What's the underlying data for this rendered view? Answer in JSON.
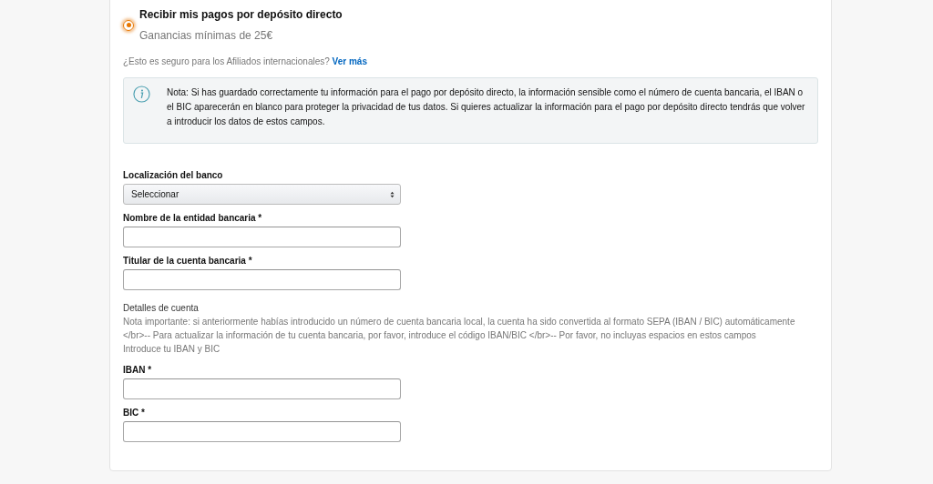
{
  "payment_option": {
    "title": "Recibir mis pagos por depósito directo",
    "subtitle": "Ganancias mínimas de 25€",
    "selected": true
  },
  "safety_question": {
    "text": "¿Esto es seguro para los Afiliados internacionales?",
    "link": "Ver más"
  },
  "notice": "Nota: Si has guardado correctamente tu información para el pago por depósito directo, la información sensible como el número de cuenta bancaria, el IBAN o el BIC aparecerán en blanco para proteger la privacidad de tus datos. Si quieres actualizar la información para el pago por depósito directo tendrás que volver a introducir los datos de estos campos.",
  "bank_fields": [
    {
      "kind": "select",
      "label": "Localización del banco",
      "value": "Seleccionar"
    },
    {
      "kind": "text",
      "label": "Nombre de la entidad bancaria *"
    },
    {
      "kind": "text",
      "label": "Titular de la cuenta bancaria *"
    }
  ],
  "account_details": {
    "heading": "Detalles de cuenta",
    "note": "Nota importante: si anteriormente habías introducido un número de cuenta bancaria local, la cuenta ha sido convertida al formato SEPA (IBAN / BIC) automáticamente </br>-- Para actualizar la información de tu cuenta bancaria, por favor, introduce el código IBAN/BIC </br>-- Por favor, no incluyas espacios en estos campos",
    "hint": "Introduce tu IBAN y BIC"
  },
  "account_fields": [
    {
      "kind": "text",
      "label": "IBAN *"
    },
    {
      "kind": "text",
      "label": "BIC *"
    }
  ]
}
